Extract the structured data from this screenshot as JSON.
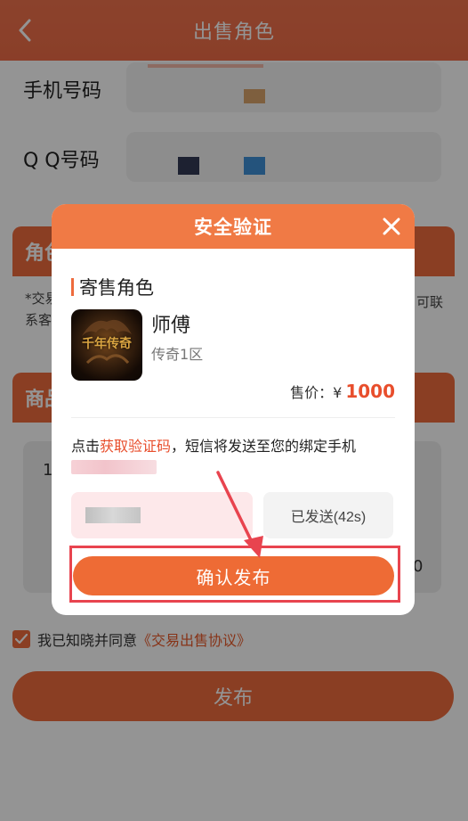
{
  "header": {
    "title": "出售角色",
    "back_icon": "chevron-left-icon"
  },
  "form": {
    "phone_label": "手机号码",
    "qq_label": "Q Q号码",
    "role_section_label": "角色",
    "note_left": "*交易",
    "note_left_2": "系客",
    "note_right": "可联",
    "goods_section_label": "商品",
    "goods_left_char": "1",
    "goods_right_char": "0"
  },
  "agreement": {
    "text": "我已知晓并同意",
    "link": "《交易出售协议》",
    "checked": true
  },
  "publish_label": "发布",
  "modal": {
    "title": "安全验证",
    "section_title": "寄售角色",
    "role": {
      "name": "师傅",
      "server": "传奇1区",
      "image_text": "千年传奇"
    },
    "price_label": "售价：¥",
    "price_value": "1000",
    "sms": {
      "prefix": "点击",
      "link": "获取验证码",
      "suffix": "，短信将发送至您的绑定手机"
    },
    "sent_label": "已发送(42s)",
    "confirm_label": "确认发布"
  },
  "colors": {
    "accent": "#ee6b3d",
    "price": "#e84e2c",
    "highlight": "#e8444f"
  }
}
